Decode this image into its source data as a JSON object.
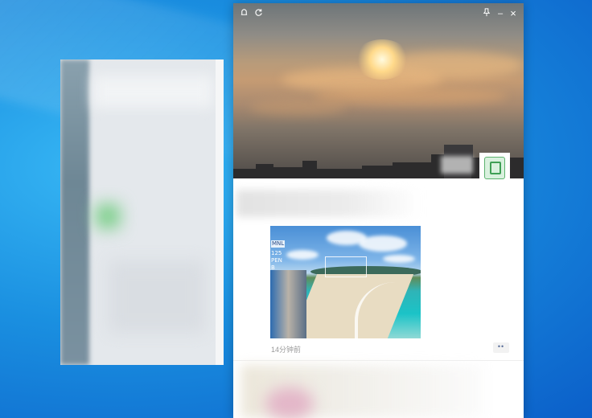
{
  "window": {
    "titlebar_icons": [
      "bell-icon",
      "refresh-icon",
      "pin-icon",
      "minimize-icon",
      "close-icon"
    ],
    "minimize_glyph": "–",
    "close_glyph": "×"
  },
  "post": {
    "image_overlay": {
      "line1": "MNL",
      "line2": "125",
      "line3": "PEN",
      "line4": "B"
    },
    "timestamp": "14分钟前",
    "more_glyph": "••"
  },
  "colors": {
    "desktop_blue": "#1a8fe0",
    "window_bg": "#ffffff",
    "timestamp_gray": "#9a9a9a",
    "more_button_blue": "#5a6f9a"
  }
}
